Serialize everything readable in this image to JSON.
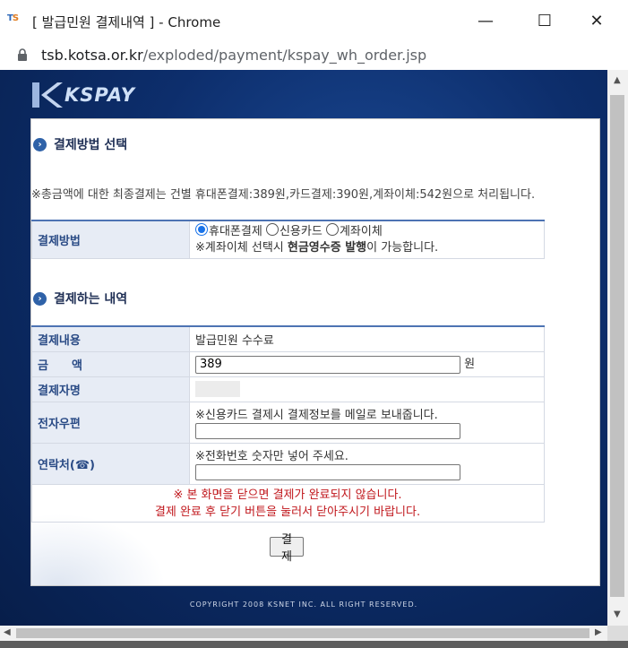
{
  "window": {
    "logo_main": "T",
    "logo_accent": "S",
    "title": "[ 발급민원 결제내역 ] - Chrome",
    "minimize_glyph": "—",
    "maximize_glyph": "☐",
    "close_glyph": "✕"
  },
  "address": {
    "domain": "tsb.kotsa.or.kr",
    "path": "/exploded/payment/kspay_wh_order.jsp"
  },
  "brand": {
    "logo": "KSPAY"
  },
  "section1": {
    "title": "결제방법 선택",
    "notice": "※총금액에 대한 최종결제는 건별 휴대폰결제:389원,카드결제:390원,계좌이체:542원으로 처리됩니다.",
    "method_label": "결제방법",
    "options": [
      {
        "label": "휴대폰결제",
        "selected": true
      },
      {
        "label": "신용카드",
        "selected": false
      },
      {
        "label": "계좌이체",
        "selected": false
      }
    ],
    "hint_prefix": "※계좌이체 선택시 ",
    "hint_bold": "현금영수증 발행",
    "hint_suffix": "이 가능합니다."
  },
  "section2": {
    "title": "결제하는 내역",
    "rows": {
      "content_label": "결제내용",
      "content_value": "발급민원 수수료",
      "amount_label": "금　　액",
      "amount_value": "389",
      "amount_unit": "원",
      "payer_label": "결제자명",
      "email_label": "전자우편",
      "email_hint": "※신용카드 결제시 결제정보를 메일로 보내줍니다.",
      "phone_label": "연락처(☎)",
      "phone_hint": "※전화번호 숫자만 넣어 주세요."
    }
  },
  "warning": {
    "line1": "※ 본 화면을 닫으면 결제가 완료되지 않습니다.",
    "line2": "결제 완료 후 닫기 버튼을 눌러서 닫아주시기 바랍니다."
  },
  "pay_button": "결 제",
  "copyright": "COPYRIGHT 2008 KSNET INC. ALL RIGHT RESERVED.",
  "colors": {
    "accent": "#2f62a8",
    "warning": "#c0161b",
    "background": "#0d2e6c"
  }
}
